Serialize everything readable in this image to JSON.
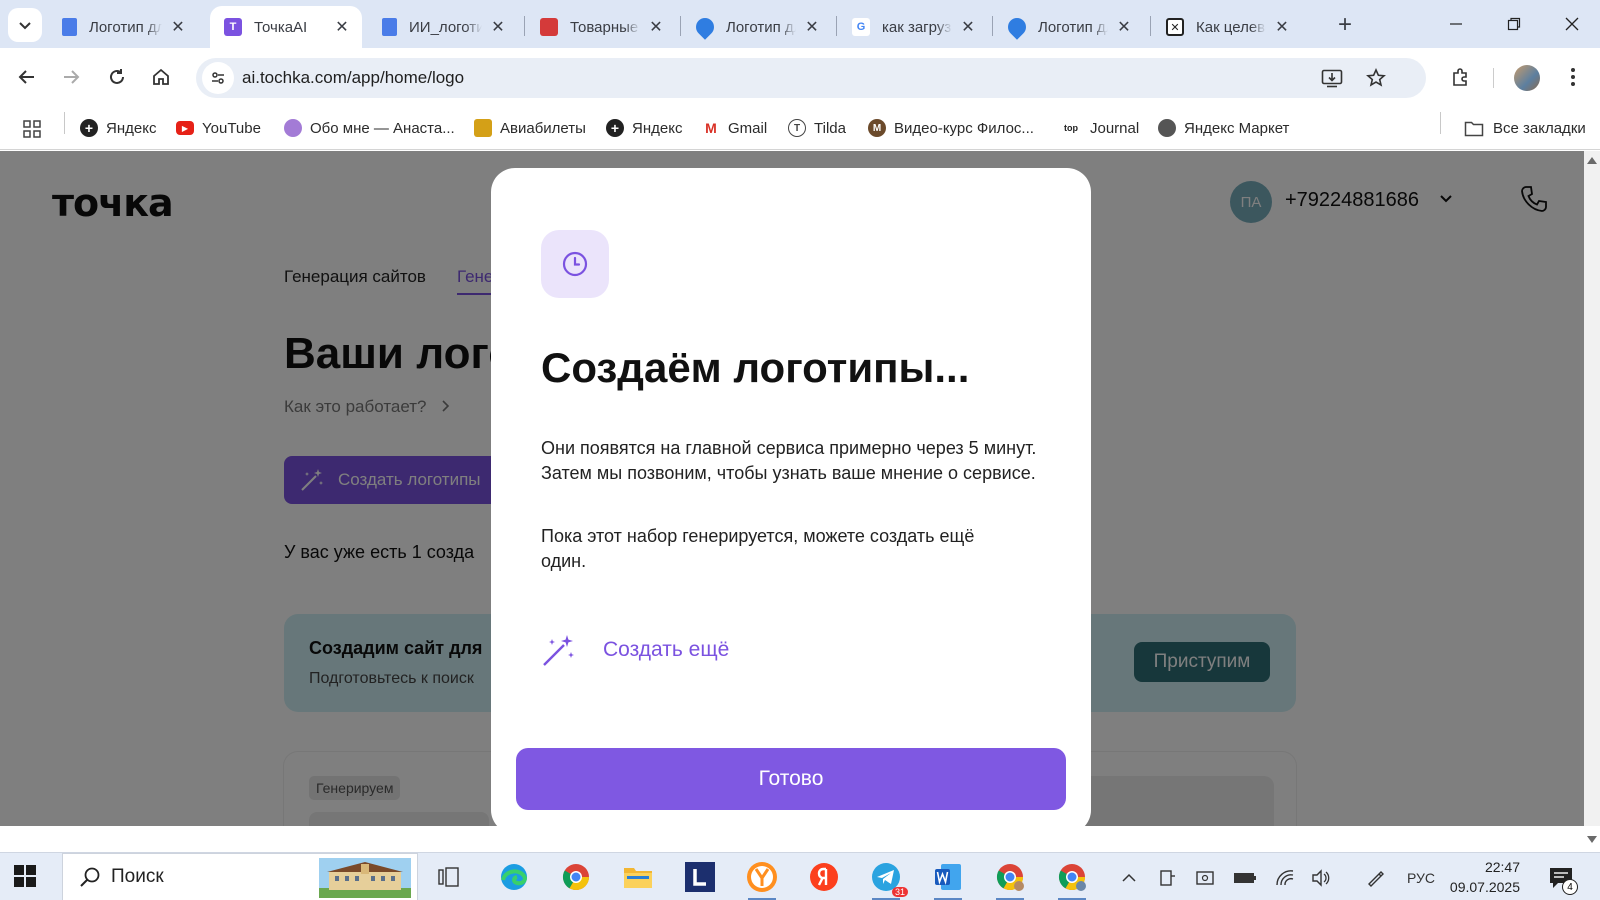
{
  "browser": {
    "tabs": [
      {
        "title": "Логотип для",
        "favicon": "google-docs-icon",
        "color": "#4a7ce8",
        "active": false
      },
      {
        "title": "ТочкаAI",
        "favicon": "tochka-ai-icon",
        "color": "#7b52e0",
        "active": true
      },
      {
        "title": "ИИ_логотип",
        "favicon": "google-docs-icon",
        "color": "#4a7ce8",
        "active": false
      },
      {
        "title": "Товарные знаки",
        "favicon": "rospatent-icon",
        "color": "#d43a3a",
        "active": false
      },
      {
        "title": "Логотип для",
        "favicon": "drop-icon",
        "color": "#2f7de1",
        "active": false
      },
      {
        "title": "как загрузить",
        "favicon": "google-g-icon",
        "color": "#4285f4",
        "active": false
      },
      {
        "title": "Логотип для",
        "favicon": "drop-icon",
        "color": "#2f7de1",
        "active": false
      },
      {
        "title": "Как целевой",
        "favicon": "x-box-icon",
        "color": "#222222",
        "active": false
      }
    ],
    "url": "ai.tochka.com/app/home/logo",
    "bookmarks": [
      {
        "label": "Яндекс",
        "icon": "yandex-icon",
        "color": "#222222"
      },
      {
        "label": "YouTube",
        "icon": "youtube-icon",
        "color": "#e62117"
      },
      {
        "label": "Обо мне — Анаста...",
        "icon": "flower-icon",
        "color": "#a37bd6"
      },
      {
        "label": "Авиабилеты",
        "icon": "aviasales-icon",
        "color": "#e8a000"
      },
      {
        "label": "Яндекс",
        "icon": "yandex-icon",
        "color": "#222222"
      },
      {
        "label": "Gmail",
        "icon": "gmail-icon",
        "color": "#d93025"
      },
      {
        "label": "Tilda",
        "icon": "tilda-icon",
        "color": "#444444"
      },
      {
        "label": "Видео-курс Филос...",
        "icon": "course-icon",
        "color": "#6b4a2b"
      },
      {
        "label": "Journal",
        "icon": "journal-icon",
        "color": "#222222"
      },
      {
        "label": "Яндекс Маркет",
        "icon": "globe-icon",
        "color": "#555555"
      }
    ],
    "all_bookmarks": "Все закладки"
  },
  "page": {
    "logo": "точка",
    "user_initials": "ПА",
    "phone": "+79224881686",
    "nav_tabs": [
      "Генерация сайтов",
      "Гене"
    ],
    "heading": "Ваши лого",
    "how_it_works": "Как это работает?",
    "create_button": "Создать логотипы",
    "have_text": "У вас уже есть 1 созда",
    "banner_title": "Создадим сайт для",
    "banner_subtitle": "Подготовьтесь к поиск",
    "banner_button": "Приступим",
    "card_badge": "Генерируем"
  },
  "modal": {
    "title": "Создаём логотипы...",
    "paragraph1": "Они появятся на главной сервиса примерно через 5 минут. Затем мы позвоним, чтобы узнать ваше мнение о сервисе.",
    "paragraph2": "Пока этот набор генерируется, можете создать ещё один.",
    "create_again": "Создать ещё",
    "done": "Готово",
    "accent": "#7b52e0"
  },
  "taskbar": {
    "search": "Поиск",
    "language": "РУС",
    "time": "22:47",
    "date": "09.07.2025",
    "telegram_badge": "31",
    "notifications": "4"
  }
}
